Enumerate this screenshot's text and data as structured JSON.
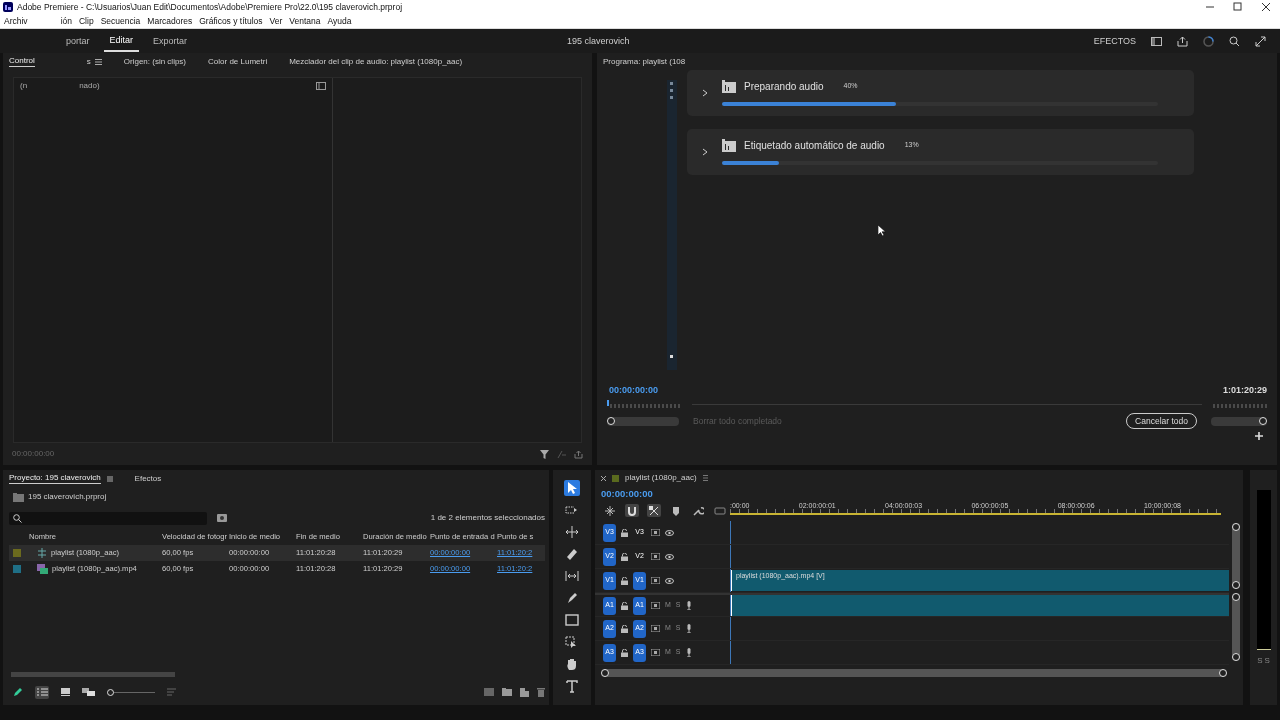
{
  "window": {
    "title": "Adobe Premiere - C:\\Usuarios\\Juan Edit\\Documentos\\Adobe\\Premiere Pro\\22.0\\195 claverovich.prproj"
  },
  "menu": [
    "Archiv",
    "ión",
    "Clip",
    "Secuencia",
    "Marcadores",
    "Gráficos y títulos",
    "Ver",
    "Ventana",
    "Ayuda"
  ],
  "header": {
    "tabs": [
      {
        "label": "portar",
        "selected": false
      },
      {
        "label": "Editar",
        "selected": true
      },
      {
        "label": "Exportar",
        "selected": false
      }
    ],
    "project": "195 claverovich",
    "effects": "EFECTOS"
  },
  "source_panel": {
    "tabs": [
      {
        "label": "Control",
        "selected": true
      },
      {
        "label": "Origen: (sin clips)",
        "selected": false
      },
      {
        "label": "Color de Lumetri",
        "selected": false
      },
      {
        "label": "Mezclador del clip de audio: playlist (1080p_aac)",
        "selected": false
      }
    ],
    "tab_tail": "s",
    "message_start": "(n",
    "message_end": "nado)",
    "timecode": "00:00:00:00"
  },
  "program_panel": {
    "title": "Programa: playlist (108",
    "tasks": [
      {
        "label": "Preparando audio",
        "percent": "40%",
        "level": 0.4
      },
      {
        "label": "Etiquetado automático de audio",
        "percent": "13%",
        "level": 0.13
      }
    ],
    "timecode": "00:00:00:00",
    "duration": "1:01:20:29",
    "clear_label": "Borrar todo completado",
    "clear_disabled": true,
    "cancel_button": "Cancelar todo",
    "zoom_start": {
      "level": 0
    },
    "zoom_end": {
      "level": 1
    }
  },
  "project": {
    "tabs": [
      {
        "label": "Proyecto: 195 claverovich",
        "selected": true
      },
      {
        "label": "Efectos",
        "selected": false
      }
    ],
    "file": "195 claverovich.prproj",
    "selection_count": "1 de 2 elementos seleccionados",
    "columns": [
      "Nombre",
      "Velocidad de fotogr",
      "Inicio de medio",
      "Fin de medio",
      "Duración de medio",
      "Punto de entrada d",
      "Punto de s"
    ],
    "rows": [
      {
        "kind": "sequence",
        "color": "#6b6a1e",
        "selected": true,
        "cells": [
          "playlist (1080p_aac)",
          "60,00 fps",
          "00:00:00:00",
          "11:01:20:28",
          "11:01:20:29",
          "00:00:00:00",
          "11:01:20:2"
        ]
      },
      {
        "kind": "clip",
        "color": "#1f6f86",
        "selected": false,
        "cells": [
          "playlist (1080p_aac).mp4",
          "60,00 fps",
          "00:00:00:00",
          "11:01:20:28",
          "11:01:20:29",
          "00:00:00:00",
          "11:01:20:2"
        ]
      }
    ],
    "list_view_selected": true,
    "icon_size": {
      "level": 0
    }
  },
  "tools": [
    {
      "selected": true
    },
    {
      "selected": false
    },
    {
      "selected": false
    },
    {
      "selected": false
    },
    {
      "selected": false
    },
    {
      "selected": false
    },
    {
      "selected": false
    },
    {
      "selected": false
    },
    {
      "selected": false
    },
    {
      "selected": false
    }
  ],
  "timeline": {
    "name": "playlist (1080p_aac)",
    "timecode": "00:00:00:00",
    "toolbar": [
      {
        "selected": false
      },
      {
        "selected": true
      },
      {
        "selected": true
      },
      {
        "selected": false
      },
      {
        "selected": false
      },
      {
        "selected": false
      }
    ],
    "ruler": [
      ":00:00",
      "02:00:00:01",
      "04:00:00:03",
      "06:00:00:05",
      "08:00:00:06",
      "10:00:00:08"
    ],
    "tracks": [
      {
        "kind": "video",
        "source": "V3",
        "name": "V3",
        "targeted": false
      },
      {
        "kind": "video",
        "source": "V2",
        "name": "V2",
        "targeted": false
      },
      {
        "kind": "video",
        "source": "V1",
        "name": "V1",
        "targeted": true,
        "clip": {
          "kind": "video",
          "label": "playlist (1080p_aac).mp4 [V]"
        }
      },
      {
        "kind": "audio",
        "source": "A1",
        "name": "A1",
        "targeted": true,
        "mute": "M",
        "solo": "S",
        "clip": {
          "kind": "audio"
        }
      },
      {
        "kind": "audio",
        "source": "A2",
        "name": "A2",
        "targeted": true,
        "mute": "M",
        "solo": "S"
      },
      {
        "kind": "audio",
        "source": "A3",
        "name": "A3",
        "targeted": true,
        "mute": "M",
        "solo": "S"
      }
    ]
  },
  "meter": {
    "labels": [
      "S",
      "S"
    ]
  }
}
